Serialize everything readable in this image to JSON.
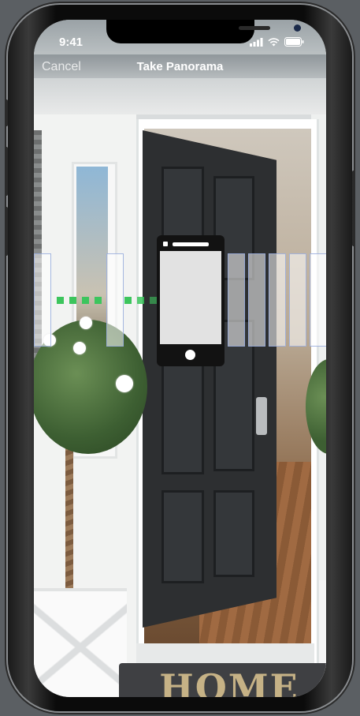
{
  "status_bar": {
    "time": "9:41",
    "icons": [
      "cellular-signal-icon",
      "wifi-icon",
      "battery-icon"
    ]
  },
  "nav": {
    "cancel_label": "Cancel",
    "title": "Take Panorama"
  },
  "scene": {
    "doormat_text": "HOME"
  },
  "panorama": {
    "guide_color": "#3cc55d",
    "guide_dot_count": 8,
    "captured_frame_count": 8,
    "pending_frame_count": 1
  },
  "colors": {
    "accent_green": "#3cc55d",
    "nav_text": "#ffffff"
  }
}
